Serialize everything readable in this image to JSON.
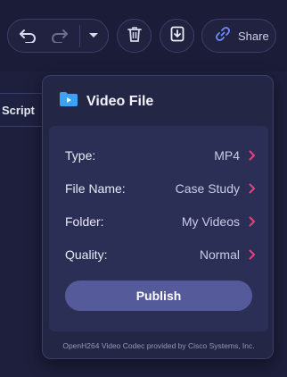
{
  "toolbar": {
    "share_label": "Share"
  },
  "editor": {
    "tab_label": "Script"
  },
  "popup": {
    "title": "Video File",
    "rows": [
      {
        "label": "Type:",
        "value": "MP4"
      },
      {
        "label": "File Name:",
        "value": "Case Study"
      },
      {
        "label": "Folder:",
        "value": "My Videos"
      },
      {
        "label": "Quality:",
        "value": "Normal"
      }
    ],
    "publish_label": "Publish",
    "footnote": "OpenH264 Video Codec provided by Cisco Systems, Inc."
  },
  "colors": {
    "accent": "#e0447c",
    "button": "#545a9a",
    "link_icon": "#6f8cff",
    "folder_icon": "#3aa3f5"
  },
  "icons": [
    "undo-icon",
    "redo-icon",
    "chevron-down-icon",
    "trash-icon",
    "download-icon",
    "link-icon",
    "folder-video-icon",
    "chevron-right-icon"
  ]
}
